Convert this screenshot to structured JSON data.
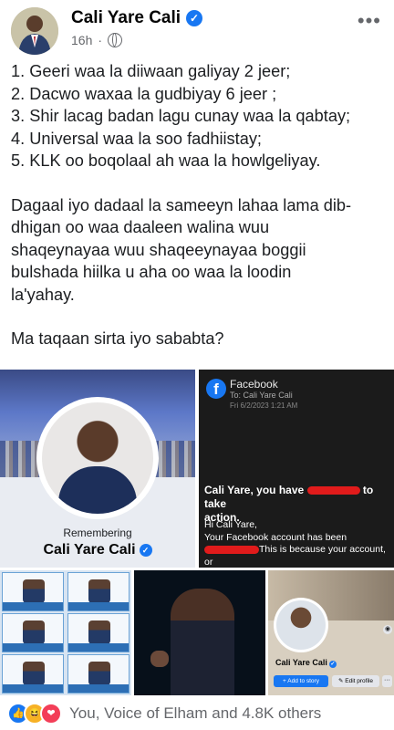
{
  "post": {
    "author": "Cali Yare Cali",
    "time": "16h",
    "more_icon": "more-dots-icon",
    "audience_icon": "globe-icon",
    "list": [
      "1. Geeri waa la diiwaan galiyay 2 jeer;",
      "2. Dacwo waxaa la gudbiyay 6 jeer ;",
      "3. Shir lacag badan lagu cunay waa la qabtay;",
      "4. Universal waa la soo fadhiistay;",
      "5. KLK oo boqolaal ah waa la howlgeliyay."
    ],
    "paragraph": [
      "Dagaal iyo dadaal la sameeyn lahaa lama dib-",
      "dhigan oo waa daaleen walina wuu",
      "shaqeynayaa wuu shaqeeynayaa boggii",
      "bulshada hiilka u aha oo waa la loodin",
      "la'yahay."
    ],
    "question": "Ma taqaan sirta iyo sababta?"
  },
  "memorial": {
    "label": "Remembering",
    "name": "Cali Yare Cali"
  },
  "email": {
    "from": "Facebook",
    "to": "To: Cali Yare Cali",
    "date": "Fri 6/2/2023 1:21 AM",
    "title_a": "Cali Yare, you have",
    "title_b": "to take",
    "title_c": "action.",
    "greeting": "Hi Cali Yare,",
    "line1": "Your Facebook account has been",
    "line2": "This is because your account, or"
  },
  "profile": {
    "name": "Cali Yare Cali",
    "add_story": "+ Add to story",
    "edit_profile": "✎ Edit profile",
    "more": "···"
  },
  "reactions": {
    "icons": [
      "like-icon",
      "haha-icon",
      "love-icon"
    ],
    "summary": "You, Voice of Elham and 4.8K others"
  },
  "colors": {
    "accent": "#1877f2",
    "redaction": "#e11b1b"
  }
}
